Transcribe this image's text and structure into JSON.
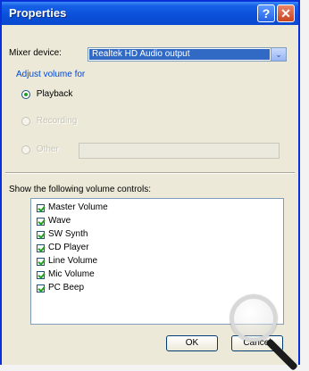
{
  "window": {
    "title": "Properties",
    "help_glyph": "?",
    "close_glyph": "✕"
  },
  "mixer": {
    "label": "Mixer device:",
    "selected": "Realtek HD Audio output",
    "arrow_glyph": "⌄"
  },
  "adjust": {
    "title": "Adjust volume for",
    "options": [
      {
        "label": "Playback",
        "selected": true,
        "enabled": true
      },
      {
        "label": "Recording",
        "selected": false,
        "enabled": false
      },
      {
        "label": "Other",
        "selected": false,
        "enabled": false
      }
    ]
  },
  "controls": {
    "label": "Show the following volume controls:",
    "items": [
      {
        "label": "Master Volume",
        "checked": true
      },
      {
        "label": "Wave",
        "checked": true
      },
      {
        "label": "SW Synth",
        "checked": true
      },
      {
        "label": "CD Player",
        "checked": true
      },
      {
        "label": "Line Volume",
        "checked": true
      },
      {
        "label": "Mic Volume",
        "checked": true
      },
      {
        "label": "PC Beep",
        "checked": true
      }
    ]
  },
  "buttons": {
    "ok": "OK",
    "cancel": "Cancel"
  },
  "colors": {
    "titlebar": "#0a4fd8",
    "dialog_bg": "#ece9d8",
    "selection": "#316ac5",
    "check_green": "#21a121"
  }
}
